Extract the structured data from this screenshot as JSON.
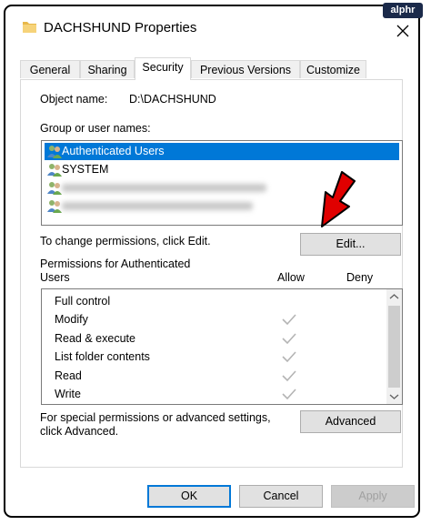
{
  "badge": "alphr",
  "window": {
    "title": "DACHSHUND Properties"
  },
  "tabs": [
    "General",
    "Sharing",
    "Security",
    "Previous Versions",
    "Customize"
  ],
  "active_tab": "Security",
  "object_name": {
    "label": "Object name:",
    "value": "D:\\DACHSHUND"
  },
  "group_users": {
    "label": "Group or user names:",
    "items": [
      "Authenticated Users",
      "SYSTEM"
    ],
    "selected": "Authenticated Users"
  },
  "change_perm": {
    "text": "To change permissions, click Edit.",
    "edit_label": "Edit..."
  },
  "permissions": {
    "label_line1": "Permissions for Authenticated",
    "label_line2": "Users",
    "allow_header": "Allow",
    "deny_header": "Deny",
    "rows": [
      {
        "name": "Full control",
        "allow": false
      },
      {
        "name": "Modify",
        "allow": true
      },
      {
        "name": "Read & execute",
        "allow": true
      },
      {
        "name": "List folder contents",
        "allow": true
      },
      {
        "name": "Read",
        "allow": true
      },
      {
        "name": "Write",
        "allow": true
      }
    ]
  },
  "advanced": {
    "text_line1": "For special permissions or advanced settings,",
    "text_line2": "click Advanced.",
    "button": "Advanced"
  },
  "footer": {
    "ok": "OK",
    "cancel": "Cancel",
    "apply": "Apply"
  },
  "colors": {
    "selection": "#0078d7",
    "arrow": "#e00000",
    "badge_bg": "#1b2a4a"
  }
}
